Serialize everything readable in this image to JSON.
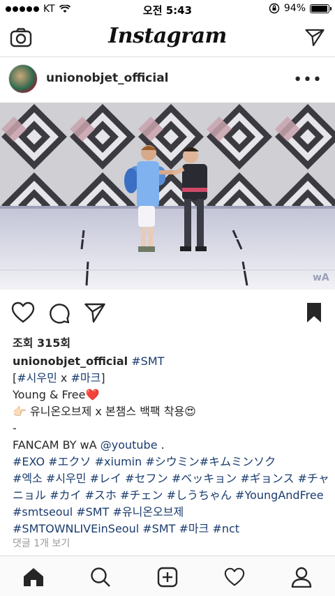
{
  "status_bar": {
    "carrier": "KT",
    "time": "오전 5:43",
    "battery": "94%",
    "battery_level": 0.94
  },
  "app": {
    "title": "Instagram"
  },
  "post": {
    "username": "unionobjet_official",
    "views": "조회 315회",
    "caption_lines": [
      [
        {
          "t": "unionobjet_official",
          "c": "uname"
        },
        {
          "t": " "
        },
        {
          "t": "#SMT",
          "c": "tag"
        }
      ],
      [
        {
          "t": "["
        },
        {
          "t": "#시우민",
          "c": "tag"
        },
        {
          "t": " x "
        },
        {
          "t": "#마크",
          "c": "tag"
        },
        {
          "t": "]"
        }
      ],
      [
        {
          "t": "Young & Free❤️"
        }
      ],
      [
        {
          "t": "👉🏻 유니온오브제 x 본챔스 백팩 착용😍"
        }
      ],
      [
        {
          "t": "-"
        }
      ],
      [
        {
          "t": "FANCAM BY wA "
        },
        {
          "t": "@youtube",
          "c": "tag"
        },
        {
          "t": " ."
        }
      ],
      [
        {
          "t": "#EXO #エクソ #xiumin #シウミン#キムミンソク",
          "c": "tag"
        }
      ],
      [
        {
          "t": "#엑소 #시우민 #レイ #セフン #ベッキョン  #ギョンス #チャ",
          "c": "tag"
        }
      ],
      [
        {
          "t": "ニョル #カイ #スホ #チェン #しうちゃん #YoungAndFree",
          "c": "tag"
        }
      ],
      [
        {
          "t": "#smtseoul #SMT #유니온오브제",
          "c": "tag"
        }
      ],
      [
        {
          "t": "#SMTOWNLIVEinSeoul #SMT #마크 #nct",
          "c": "tag"
        }
      ]
    ],
    "comments_link": "댓글 1개 보기",
    "watermark": "wA"
  },
  "icons": {
    "camera": "camera-icon",
    "send": "send-icon",
    "more": "more-icon",
    "heart": "heart-icon",
    "comment": "comment-icon",
    "share": "share-icon",
    "bookmark": "bookmark-icon",
    "home": "home-icon",
    "search": "search-icon",
    "add": "add-icon",
    "activity": "heart-icon",
    "profile": "profile-icon"
  }
}
